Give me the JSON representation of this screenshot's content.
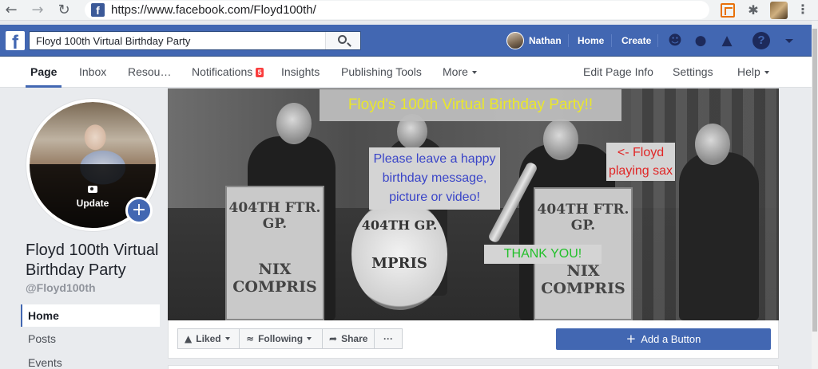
{
  "browser": {
    "url": "https://www.facebook.com/Floyd100th/",
    "favicon_letter": "f",
    "back_glyph": "←",
    "forward_glyph": "→",
    "reload_glyph": "↻",
    "extensions_glyph": "✱",
    "menu_glyph": "⋮"
  },
  "fbbar": {
    "logo_letter": "f",
    "search_value": "Floyd 100th Virtual Birthday Party",
    "user_name": "Nathan",
    "home_label": "Home",
    "create_label": "Create",
    "help_glyph": "?",
    "icons": [
      "friends-icon",
      "messenger-icon",
      "notifications-icon",
      "help-icon",
      "account-menu-icon"
    ]
  },
  "tabs": [
    {
      "label": "Page",
      "active": true
    },
    {
      "label": "Inbox"
    },
    {
      "label": "Resou…"
    },
    {
      "label": "Notifications",
      "badge": "5"
    },
    {
      "label": "Insights"
    },
    {
      "label": "Publishing Tools"
    },
    {
      "label": "More"
    },
    {
      "label": "Edit Page Info"
    },
    {
      "label": "Settings"
    },
    {
      "label": "Help"
    }
  ],
  "profile": {
    "update_label": "Update",
    "plus_glyph": "+",
    "page_name": "Floyd 100th Virtual Birthday Party",
    "handle": "@Floyd100th"
  },
  "left_nav": [
    {
      "label": "Home",
      "active": true
    },
    {
      "label": "Posts"
    },
    {
      "label": "Events"
    }
  ],
  "cover": {
    "title": "Floyd's 100th Virtual Birthday Party!!",
    "message": "Please leave a happy birthday message, picture or video!",
    "floyd_note": "<- Floyd playing sax",
    "thanks": "THANK YOU!",
    "stand_text_1": "404TH FTR. GP.",
    "stand_text_2": "NIX COMPRIS",
    "drum_text_1": "404TH GP.",
    "drum_text_2": "MPRIS"
  },
  "actions": {
    "liked_label": "Liked",
    "following_label": "Following",
    "share_label": "Share",
    "more_label": "···",
    "add_button_label": "Add a Button",
    "add_glyph": "+"
  },
  "colors": {
    "facebook_blue": "#4267b2",
    "title_yellow": "#f2ef2a",
    "message_blue": "#3a45c8",
    "floyd_red": "#e02626",
    "thanks_green": "#22c02a",
    "badge_red": "#fa3e3e"
  }
}
